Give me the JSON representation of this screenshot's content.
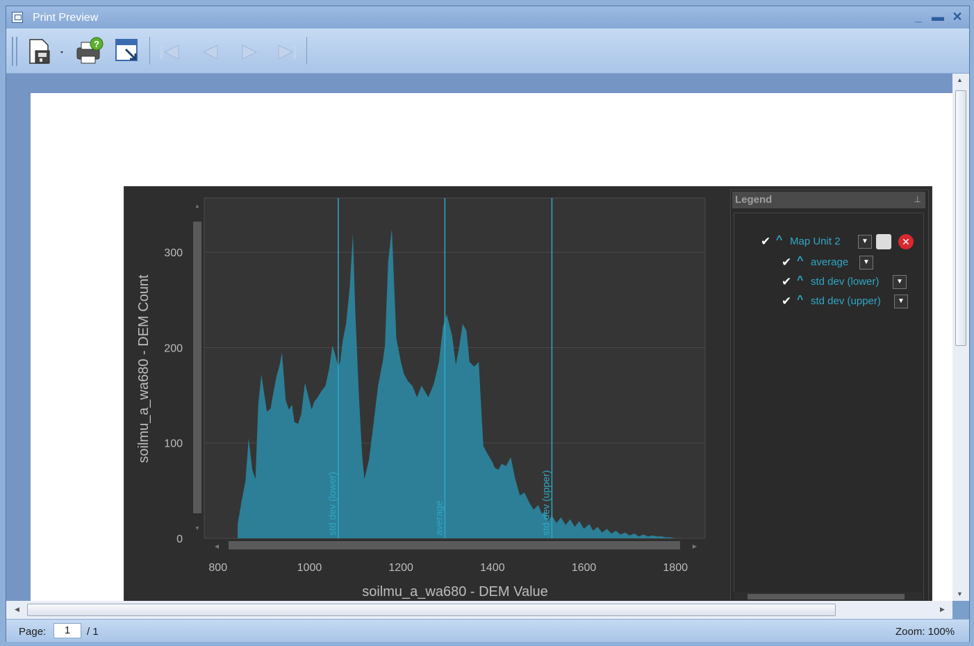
{
  "window": {
    "title": "Print Preview"
  },
  "toolbar": {
    "save_icon": "save-icon",
    "print_icon": "print-icon",
    "export_icon": "export-icon",
    "nav": [
      "first-page-icon",
      "previous-page-icon",
      "next-page-icon",
      "last-page-icon"
    ]
  },
  "status": {
    "page_label": "Page:",
    "page_value": "1",
    "page_total": "/ 1",
    "zoom": "Zoom: 100%"
  },
  "legend": {
    "title": "Legend",
    "items": [
      {
        "label": "Map Unit 2",
        "checked": true
      },
      {
        "label": "average",
        "checked": true
      },
      {
        "label": "std dev (lower)",
        "checked": true
      },
      {
        "label": "std dev (upper)",
        "checked": true
      }
    ]
  },
  "colors": {
    "area_fill": "#2c7f96",
    "accent": "#2fa7c5",
    "chart_bg": "#353535"
  },
  "chart_data": {
    "type": "area",
    "xlabel": "soilmu_a_wa680 - DEM Value",
    "ylabel": "soilmu_a_wa680 - DEM Count",
    "xlim": [
      770,
      1865
    ],
    "ylim": [
      0,
      357
    ],
    "xticks": [
      800,
      1000,
      1200,
      1400,
      1600,
      1800
    ],
    "yticks": [
      0,
      100,
      200,
      300
    ],
    "grid": true,
    "reference_lines": [
      {
        "label": "std dev (lower)",
        "x": 1063
      },
      {
        "label": "average",
        "x": 1296
      },
      {
        "label": "std dev (upper)",
        "x": 1530
      }
    ],
    "x": [
      843,
      852,
      860,
      867,
      875,
      882,
      888,
      895,
      900,
      907,
      915,
      920,
      928,
      935,
      940,
      948,
      955,
      962,
      967,
      975,
      982,
      990,
      997,
      1005,
      1010,
      1018,
      1027,
      1035,
      1043,
      1050,
      1055,
      1063,
      1067,
      1073,
      1080,
      1088,
      1095,
      1100,
      1108,
      1115,
      1120,
      1130,
      1140,
      1150,
      1160,
      1165,
      1172,
      1180,
      1190,
      1200,
      1207,
      1215,
      1225,
      1235,
      1245,
      1260,
      1272,
      1283,
      1292,
      1300,
      1312,
      1320,
      1327,
      1335,
      1343,
      1350,
      1360,
      1370,
      1380,
      1390,
      1400,
      1405,
      1413,
      1420,
      1430,
      1440,
      1450,
      1460,
      1470,
      1480,
      1490,
      1500,
      1508,
      1515,
      1522,
      1530,
      1540,
      1550,
      1560,
      1570,
      1580,
      1590,
      1600,
      1612,
      1620,
      1630,
      1640,
      1650,
      1660,
      1670,
      1680,
      1690,
      1700,
      1710,
      1720,
      1730,
      1740,
      1750,
      1760,
      1770,
      1780,
      1790,
      1800
    ],
    "y": [
      15,
      40,
      60,
      105,
      72,
      62,
      140,
      172,
      155,
      133,
      136,
      150,
      170,
      182,
      195,
      145,
      135,
      140,
      122,
      120,
      130,
      163,
      150,
      135,
      143,
      148,
      155,
      160,
      178,
      202,
      195,
      180,
      185,
      208,
      225,
      263,
      320,
      240,
      150,
      88,
      62,
      82,
      120,
      160,
      185,
      202,
      290,
      325,
      210,
      185,
      172,
      165,
      160,
      148,
      160,
      148,
      162,
      185,
      222,
      235,
      212,
      182,
      200,
      225,
      218,
      185,
      180,
      185,
      97,
      88,
      80,
      74,
      72,
      78,
      76,
      85,
      62,
      45,
      48,
      38,
      30,
      35,
      26,
      28,
      18,
      24,
      16,
      22,
      14,
      20,
      12,
      18,
      10,
      15,
      8,
      12,
      6,
      10,
      5,
      8,
      4,
      6,
      3,
      5,
      2,
      4,
      2,
      3,
      2,
      2,
      1,
      1,
      0
    ],
    "series": []
  }
}
